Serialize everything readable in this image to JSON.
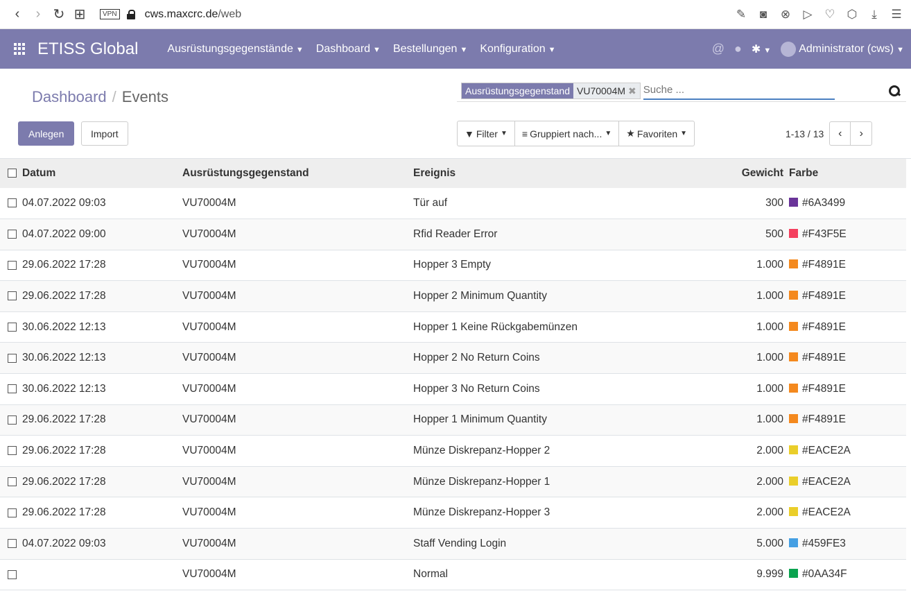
{
  "browser": {
    "url_domain": "cws.maxcrc.de",
    "url_path": "/web",
    "vpn_label": "VPN"
  },
  "navbar": {
    "brand": "ETISS Global",
    "menus": [
      "Ausrüstungsgegenstände",
      "Dashboard",
      "Bestellungen",
      "Konfiguration"
    ],
    "user": "Administrator (cws)"
  },
  "breadcrumb": {
    "parent": "Dashboard",
    "current": "Events"
  },
  "search": {
    "facet_label": "Ausrüstungsgegenstand",
    "facet_value": "VU70004M",
    "placeholder": "Suche ..."
  },
  "buttons": {
    "create": "Anlegen",
    "import": "Import"
  },
  "filters": {
    "filter": "Filter",
    "group_by": "Gruppiert nach...",
    "favorites": "Favoriten"
  },
  "pager": {
    "value": "1-13 / 13"
  },
  "table": {
    "headers": {
      "date": "Datum",
      "equipment": "Ausrüstungsgegenstand",
      "event": "Ereignis",
      "weight": "Gewicht",
      "color": "Farbe"
    },
    "rows": [
      {
        "date": "04.07.2022 09:03",
        "equipment": "VU70004M",
        "event": "Tür auf",
        "weight": "300",
        "color": "#6A3499"
      },
      {
        "date": "04.07.2022 09:00",
        "equipment": "VU70004M",
        "event": "Rfid Reader Error",
        "weight": "500",
        "color": "#F43F5E"
      },
      {
        "date": "29.06.2022 17:28",
        "equipment": "VU70004M",
        "event": "Hopper 3 Empty",
        "weight": "1.000",
        "color": "#F4891E"
      },
      {
        "date": "29.06.2022 17:28",
        "equipment": "VU70004M",
        "event": "Hopper 2 Minimum Quantity",
        "weight": "1.000",
        "color": "#F4891E"
      },
      {
        "date": "30.06.2022 12:13",
        "equipment": "VU70004M",
        "event": "Hopper 1 Keine Rückgabemünzen",
        "weight": "1.000",
        "color": "#F4891E"
      },
      {
        "date": "30.06.2022 12:13",
        "equipment": "VU70004M",
        "event": "Hopper 2 No Return Coins",
        "weight": "1.000",
        "color": "#F4891E"
      },
      {
        "date": "30.06.2022 12:13",
        "equipment": "VU70004M",
        "event": "Hopper 3 No Return Coins",
        "weight": "1.000",
        "color": "#F4891E"
      },
      {
        "date": "29.06.2022 17:28",
        "equipment": "VU70004M",
        "event": "Hopper 1 Minimum Quantity",
        "weight": "1.000",
        "color": "#F4891E"
      },
      {
        "date": "29.06.2022 17:28",
        "equipment": "VU70004M",
        "event": "Münze Diskrepanz-Hopper 2",
        "weight": "2.000",
        "color": "#EACE2A"
      },
      {
        "date": "29.06.2022 17:28",
        "equipment": "VU70004M",
        "event": "Münze Diskrepanz-Hopper 1",
        "weight": "2.000",
        "color": "#EACE2A"
      },
      {
        "date": "29.06.2022 17:28",
        "equipment": "VU70004M",
        "event": "Münze Diskrepanz-Hopper 3",
        "weight": "2.000",
        "color": "#EACE2A"
      },
      {
        "date": "04.07.2022 09:03",
        "equipment": "VU70004M",
        "event": "Staff Vending Login",
        "weight": "5.000",
        "color": "#459FE3"
      },
      {
        "date": "",
        "equipment": "VU70004M",
        "event": "Normal",
        "weight": "9.999",
        "color": "#0AA34F"
      }
    ]
  }
}
